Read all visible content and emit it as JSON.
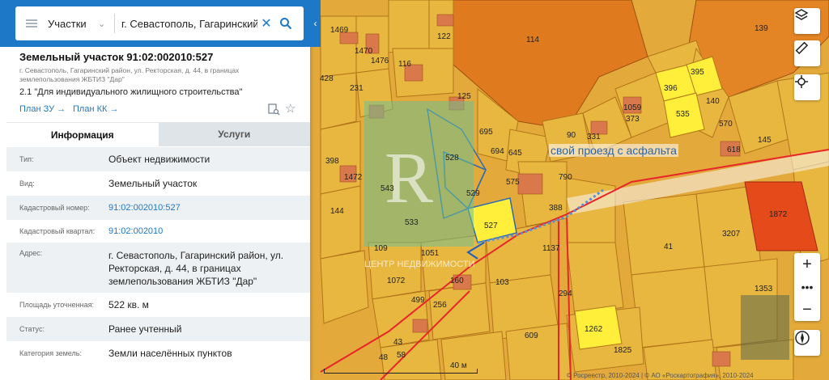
{
  "search": {
    "type_label": "Участки",
    "value": "г. Севастополь, Гагаринский р"
  },
  "parcel": {
    "title": "Земельный участок 91:02:002010:527",
    "address_small": "г. Севастополь, Гагаринский район, ул. Ректорская, д. 44, в границах землепользования ЖБТИЗ \"Дар\"",
    "purpose": "2.1 \"Для индивидуального жилищного строительства\"",
    "plan_zu": "План ЗУ →",
    "plan_kk": "План КК →"
  },
  "tabs": {
    "info": "Информация",
    "services": "Услуги"
  },
  "details": [
    {
      "label": "Тип:",
      "value": "Объект недвижимости"
    },
    {
      "label": "Вид:",
      "value": "Земельный участок"
    },
    {
      "label": "Кадастровый номер:",
      "value": "91:02:002010:527"
    },
    {
      "label": "Кадастровый квартал:",
      "value": "91:02:002010"
    },
    {
      "label": "Адрес:",
      "value": "г. Севастополь, Гагаринский район, ул. Ректорская, д. 44, в границах землепользования ЖБТИЗ \"Дар\""
    },
    {
      "label": "Площадь уточненная:",
      "value": "522 кв. м"
    },
    {
      "label": "Статус:",
      "value": "Ранее учтенный"
    },
    {
      "label": "Категория земель:",
      "value": "Земли населённых пунктов"
    }
  ],
  "map": {
    "overlay_text": "свой проезд с асфальта",
    "scale": "40 м",
    "copyright": "© Росреестр, 2010-2024 | © АО «Роскартография», 2010-2024",
    "parcel_labels": [
      "1469",
      "1470",
      "1476",
      "122",
      "114",
      "139",
      "428",
      "231",
      "116",
      "395",
      "396",
      "140",
      "535",
      "125",
      "1059",
      "373",
      "570",
      "618",
      "145",
      "695",
      "90",
      "331",
      "694",
      "645",
      "790",
      "398",
      "1472",
      "528",
      "575",
      "543",
      "529",
      "388",
      "144",
      "1872",
      "533",
      "527",
      "1137",
      "3207",
      "41",
      "1051",
      "109",
      "103",
      "160",
      "294",
      "1353",
      "499",
      "256",
      "609",
      "1262",
      "1825",
      "43",
      "58",
      "1072",
      "48"
    ],
    "controls": [
      "layers-icon",
      "ruler-icon",
      "location-icon",
      "zoom-in",
      "more",
      "zoom-out",
      "compass-icon"
    ],
    "colors": {
      "accent": "#1e78c8",
      "parcel_fill": "#e8b740",
      "building": "#e07a1f",
      "highlight": "#ffef3a",
      "boundary_red": "#e8262a"
    }
  }
}
